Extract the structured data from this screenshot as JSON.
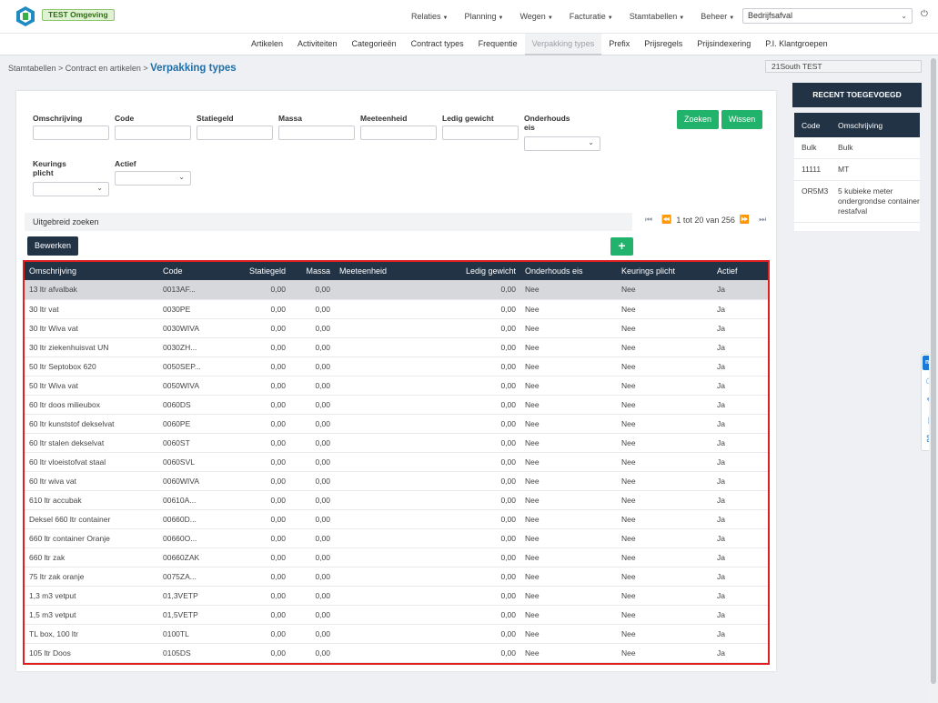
{
  "header": {
    "env_badge": "TEST Omgeving",
    "nav": [
      {
        "label": "Relaties"
      },
      {
        "label": "Planning"
      },
      {
        "label": "Wegen"
      },
      {
        "label": "Facturatie"
      },
      {
        "label": "Stamtabellen"
      },
      {
        "label": "Beheer"
      }
    ],
    "company_select": "Bedrijfsafval"
  },
  "subnav": {
    "tabs": [
      "Artikelen",
      "Activiteiten",
      "Categorieën",
      "Contract types",
      "Frequentie",
      "Verpakking types",
      "Prefix",
      "Prijsregels",
      "Prijsindexering",
      "P.I. Klantgroepen"
    ],
    "active": "Verpakking types"
  },
  "breadcrumb": {
    "path": "Stamtabellen > Contract en artikelen > ",
    "current": "Verpakking types"
  },
  "tenant": "21South TEST",
  "filters": {
    "omschrijving": "Omschrijving",
    "code": "Code",
    "statiegeld": "Statiegeld",
    "massa": "Massa",
    "meeteenheid": "Meeteenheid",
    "ledig_gewicht": "Ledig gewicht",
    "onderhouds_eis_1": "Onderhouds",
    "onderhouds_eis_2": "eis",
    "keurings_plicht_1": "Keurings",
    "keurings_plicht_2": "plicht",
    "actief": "Actief",
    "search_button": "Zoeken",
    "clear_button": "Wissen"
  },
  "advanced_search": "Uitgebreid zoeken",
  "pager": {
    "text": "1 tot 20 van 256"
  },
  "edit_button": "Bewerken",
  "add_button": "+",
  "table": {
    "columns": [
      "Omschrijving",
      "Code",
      "Statiegeld",
      "Massa",
      "Meeteenheid",
      "Ledig gewicht",
      "Onderhouds eis",
      "Keurings plicht",
      "Actief"
    ],
    "rows": [
      [
        "13 ltr afvalbak",
        "0013AF...",
        "0,00",
        "0,00",
        "",
        "0,00",
        "Nee",
        "Nee",
        "Ja"
      ],
      [
        "30 ltr vat",
        "0030PE",
        "0,00",
        "0,00",
        "",
        "0,00",
        "Nee",
        "Nee",
        "Ja"
      ],
      [
        "30 ltr Wiva vat",
        "0030WIVA",
        "0,00",
        "0,00",
        "",
        "0,00",
        "Nee",
        "Nee",
        "Ja"
      ],
      [
        "30 ltr ziekenhuisvat UN",
        "0030ZH...",
        "0,00",
        "0,00",
        "",
        "0,00",
        "Nee",
        "Nee",
        "Ja"
      ],
      [
        "50 ltr Septobox 620",
        "0050SEP...",
        "0,00",
        "0,00",
        "",
        "0,00",
        "Nee",
        "Nee",
        "Ja"
      ],
      [
        "50 ltr Wiva vat",
        "0050WIVA",
        "0,00",
        "0,00",
        "",
        "0,00",
        "Nee",
        "Nee",
        "Ja"
      ],
      [
        "60 ltr doos milieubox",
        "0060DS",
        "0,00",
        "0,00",
        "",
        "0,00",
        "Nee",
        "Nee",
        "Ja"
      ],
      [
        "60 ltr kunststof dekselvat",
        "0060PE",
        "0,00",
        "0,00",
        "",
        "0,00",
        "Nee",
        "Nee",
        "Ja"
      ],
      [
        "60 ltr stalen dekselvat",
        "0060ST",
        "0,00",
        "0,00",
        "",
        "0,00",
        "Nee",
        "Nee",
        "Ja"
      ],
      [
        "60 ltr vloeistofvat staal",
        "0060SVL",
        "0,00",
        "0,00",
        "",
        "0,00",
        "Nee",
        "Nee",
        "Ja"
      ],
      [
        "60 ltr wiva vat",
        "0060WIVA",
        "0,00",
        "0,00",
        "",
        "0,00",
        "Nee",
        "Nee",
        "Ja"
      ],
      [
        "610 ltr accubak",
        "00610A...",
        "0,00",
        "0,00",
        "",
        "0,00",
        "Nee",
        "Nee",
        "Ja"
      ],
      [
        "Deksel 660 ltr container",
        "00660D...",
        "0,00",
        "0,00",
        "",
        "0,00",
        "Nee",
        "Nee",
        "Ja"
      ],
      [
        "660 ltr container Oranje",
        "00660O...",
        "0,00",
        "0,00",
        "",
        "0,00",
        "Nee",
        "Nee",
        "Ja"
      ],
      [
        "660 ltr zak",
        "00660ZAK",
        "0,00",
        "0,00",
        "",
        "0,00",
        "Nee",
        "Nee",
        "Ja"
      ],
      [
        "75 ltr zak oranje",
        "0075ZA...",
        "0,00",
        "0,00",
        "",
        "0,00",
        "Nee",
        "Nee",
        "Ja"
      ],
      [
        "1,3 m3 vetput",
        "01,3VETP",
        "0,00",
        "0,00",
        "",
        "0,00",
        "Nee",
        "Nee",
        "Ja"
      ],
      [
        "1,5 m3 vetput",
        "01,5VETP",
        "0,00",
        "0,00",
        "",
        "0,00",
        "Nee",
        "Nee",
        "Ja"
      ],
      [
        "TL box, 100 ltr",
        "0100TL",
        "0,00",
        "0,00",
        "",
        "0,00",
        "Nee",
        "Nee",
        "Ja"
      ],
      [
        "105 ltr Doos",
        "0105DS",
        "0,00",
        "0,00",
        "",
        "0,00",
        "Nee",
        "Nee",
        "Ja"
      ]
    ]
  },
  "recent": {
    "title": "RECENT TOEGEVOEGD",
    "columns": [
      "Code",
      "Omschrijving"
    ],
    "rows": [
      [
        "Bulk",
        "Bulk"
      ],
      [
        "11111",
        "MT"
      ],
      [
        "OR5M3",
        "5 kubieke meter ondergrondse container restafval"
      ]
    ]
  },
  "sidetools": {
    "badge": "mx"
  },
  "colors": {
    "navy": "#223346",
    "green": "#21b36b",
    "link_blue": "#1f6fa8",
    "highlight_red": "#e02020"
  }
}
